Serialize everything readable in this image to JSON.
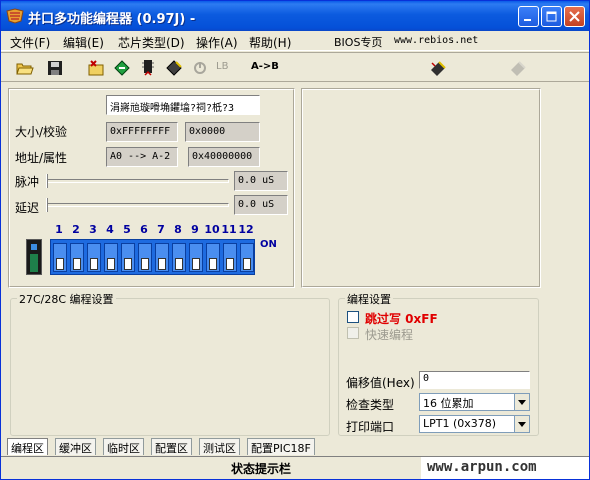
{
  "window": {
    "title": "并口多功能编程器 (0.97J) -"
  },
  "menu": {
    "items": [
      "文件(F)",
      "编辑(E)",
      "芯片类型(D)",
      "操作(A)",
      "帮助(H)"
    ],
    "bios_label": "BIOS专页",
    "url": "www.rebios.net"
  },
  "toolbar": {
    "lb_label": "LB",
    "ab_label": "A->B"
  },
  "chip": {
    "name_value": "涓嶈兘璇嗗埆鑺墖?祠?柢?3",
    "size_label": "大小/校验",
    "size_value": "0xFFFFFFFF",
    "checksum_value": "0x0000",
    "addr_label": "地址/属性",
    "addr_value": "A0 --> A-2",
    "attr_value": "0x40000000",
    "pulse_label": "脉冲",
    "pulse_value": "0.0 uS",
    "delay_label": "延迟",
    "delay_value": "0.0 uS"
  },
  "dip": {
    "numbers": [
      "1",
      "2",
      "3",
      "4",
      "5",
      "6",
      "7",
      "8",
      "9",
      "10",
      "11",
      "12"
    ],
    "on_label": "ON"
  },
  "programming_27c": {
    "title": "27C/28C 编程设置"
  },
  "programming": {
    "title": "编程设置",
    "skip_write_label": "跳过写 0xFF",
    "fast_program_label": "快速编程",
    "offset_label": "偏移值(Hex)",
    "offset_value": "0",
    "check_type_label": "检查类型",
    "check_type_value": "16 位累加",
    "port_label": "打印端口",
    "port_value": "LPT1 (0x378)"
  },
  "tabs": [
    "编程区",
    "缓冲区",
    "临时区",
    "配置区",
    "测试区",
    "配置PIC18F"
  ],
  "status": {
    "text": "状态提示栏",
    "watermark": "www.arpun.com"
  },
  "colors": {
    "titlebar": "#0A5BE8",
    "window_bg": "#ECE9D8",
    "dip_blue": "#1E6BE0",
    "warning_red": "#E00000"
  }
}
